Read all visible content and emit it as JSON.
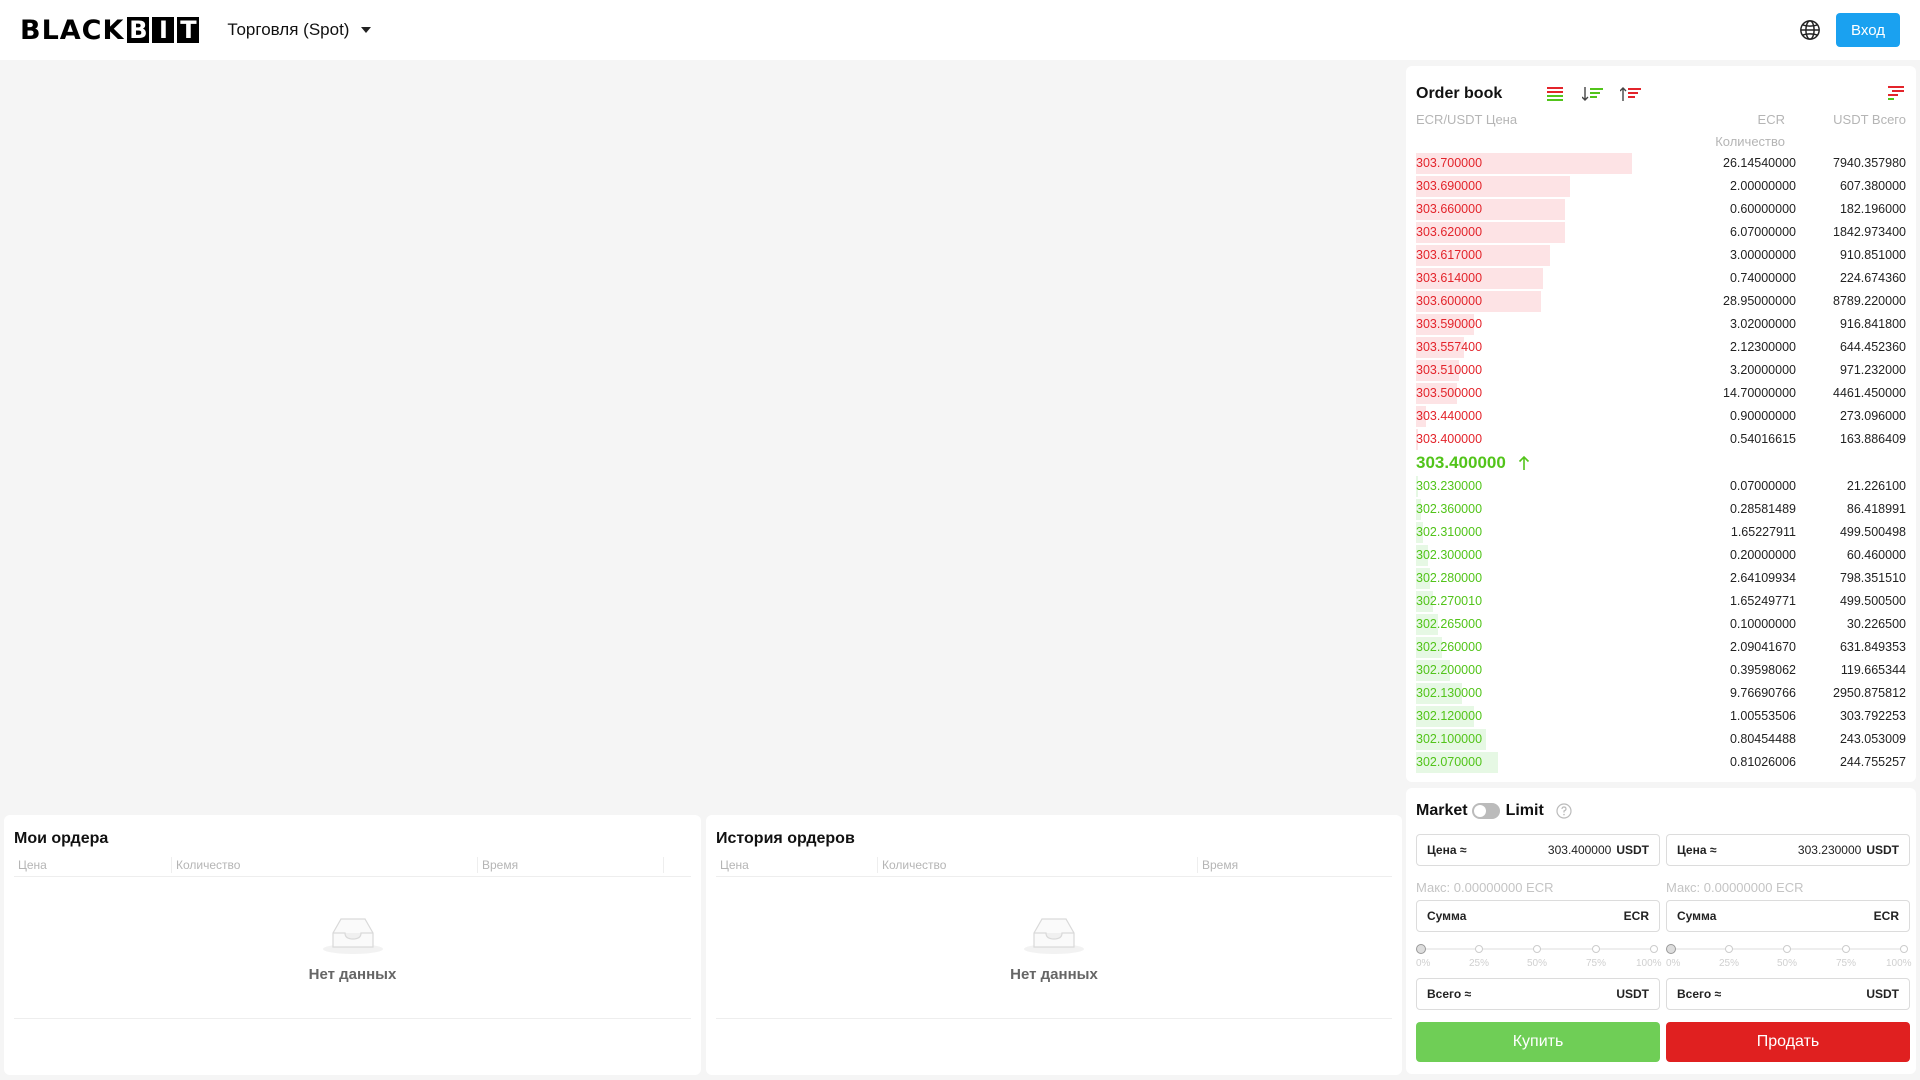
{
  "header": {
    "logo_text": "BLACKBIT",
    "logo_part1": "BLACK",
    "logo_b": "B",
    "logo_i": "I",
    "logo_t": "T",
    "market_menu": "Торговля (Spot)",
    "login_label": "Вход",
    "icons": {
      "language": "globe-icon",
      "menu": "chevron-down-icon"
    }
  },
  "orderbook": {
    "title": "Order book",
    "col_price": "ECR/USDT Цена",
    "col_amount": "ECR",
    "col_amount_sub": "Количество",
    "col_total": "USDT Всего",
    "icons": [
      "both-sides-icon",
      "bids-only-icon",
      "asks-only-icon",
      "depth-icon"
    ],
    "colors": {
      "ask": "#e3242b",
      "bid": "#52c41a",
      "ask_bg": "#fde3e5",
      "bid_bg": "#e6f8e4"
    },
    "asks": [
      {
        "price": "303.700000",
        "amount": "26.14540000",
        "total": "7940.357980",
        "depth": 0.9
      },
      {
        "price": "303.690000",
        "amount": "2.00000000",
        "total": "607.380000",
        "depth": 0.64
      },
      {
        "price": "303.660000",
        "amount": "0.60000000",
        "total": "182.196000",
        "depth": 0.62
      },
      {
        "price": "303.620000",
        "amount": "6.07000000",
        "total": "1842.973400",
        "depth": 0.62
      },
      {
        "price": "303.617000",
        "amount": "3.00000000",
        "total": "910.851000",
        "depth": 0.56
      },
      {
        "price": "303.614000",
        "amount": "0.74000000",
        "total": "224.674360",
        "depth": 0.53
      },
      {
        "price": "303.600000",
        "amount": "28.95000000",
        "total": "8789.220000",
        "depth": 0.52
      },
      {
        "price": "303.590000",
        "amount": "3.02000000",
        "total": "916.841800",
        "depth": 0.24
      },
      {
        "price": "303.557400",
        "amount": "2.12300000",
        "total": "644.452360",
        "depth": 0.2
      },
      {
        "price": "303.510000",
        "amount": "3.20000000",
        "total": "971.232000",
        "depth": 0.18
      },
      {
        "price": "303.500000",
        "amount": "14.70000000",
        "total": "4461.450000",
        "depth": 0.17
      },
      {
        "price": "303.440000",
        "amount": "0.90000000",
        "total": "273.096000",
        "depth": 0.04
      },
      {
        "price": "303.400000",
        "amount": "0.54016615",
        "total": "163.886409",
        "depth": 0.01
      }
    ],
    "last_price": "303.400000",
    "last_price_direction": "up",
    "bids": [
      {
        "price": "303.230000",
        "amount": "0.07000000",
        "total": "21.226100",
        "depth": 0.01
      },
      {
        "price": "302.360000",
        "amount": "0.28581489",
        "total": "86.418991",
        "depth": 0.02
      },
      {
        "price": "302.310000",
        "amount": "1.65227911",
        "total": "499.500498",
        "depth": 0.03
      },
      {
        "price": "302.300000",
        "amount": "0.20000000",
        "total": "60.460000",
        "depth": 0.05
      },
      {
        "price": "302.280000",
        "amount": "2.64109934",
        "total": "798.351510",
        "depth": 0.06
      },
      {
        "price": "302.270010",
        "amount": "1.65249771",
        "total": "499.500500",
        "depth": 0.07
      },
      {
        "price": "302.265000",
        "amount": "0.10000000",
        "total": "30.226500",
        "depth": 0.09
      },
      {
        "price": "302.260000",
        "amount": "2.09041670",
        "total": "631.849353",
        "depth": 0.11
      },
      {
        "price": "302.200000",
        "amount": "0.39598062",
        "total": "119.665344",
        "depth": 0.14
      },
      {
        "price": "302.130000",
        "amount": "9.76690766",
        "total": "2950.875812",
        "depth": 0.19
      },
      {
        "price": "302.120000",
        "amount": "1.00553506",
        "total": "303.792253",
        "depth": 0.24
      },
      {
        "price": "302.100000",
        "amount": "0.80454488",
        "total": "243.053009",
        "depth": 0.29
      },
      {
        "price": "302.070000",
        "amount": "0.81026006",
        "total": "244.755257",
        "depth": 0.34
      }
    ]
  },
  "trade_form": {
    "market_label": "Market",
    "limit_label": "Limit",
    "buy": {
      "price_label": "Цена ≈",
      "price_value": "303.400000",
      "price_unit": "USDT",
      "max_text": "Макс: 0.00000000 ECR",
      "amount_label": "Сумма",
      "amount_value": "",
      "amount_unit": "ECR",
      "total_label": "Всего ≈",
      "total_value": "",
      "total_unit": "USDT",
      "button": "Купить",
      "button_color": "#6fce56"
    },
    "sell": {
      "price_label": "Цена ≈",
      "price_value": "303.230000",
      "price_unit": "USDT",
      "max_text": "Макс: 0.00000000 ECR",
      "amount_label": "Сумма",
      "amount_value": "",
      "amount_unit": "ECR",
      "total_label": "Всего ≈",
      "total_value": "",
      "total_unit": "USDT",
      "button": "Продать",
      "button_color": "#e02020"
    },
    "slider_marks": [
      "0%",
      "25%",
      "50%",
      "75%",
      "100%"
    ],
    "slider_value": 0
  },
  "my_orders": {
    "title": "Мои ордера",
    "columns": [
      "Цена",
      "Количество",
      "Время",
      ""
    ],
    "empty_text": "Нет данных"
  },
  "order_history": {
    "title": "История ордеров",
    "columns": [
      "Цена",
      "Количество",
      "Время"
    ],
    "empty_text": "Нет данных"
  }
}
